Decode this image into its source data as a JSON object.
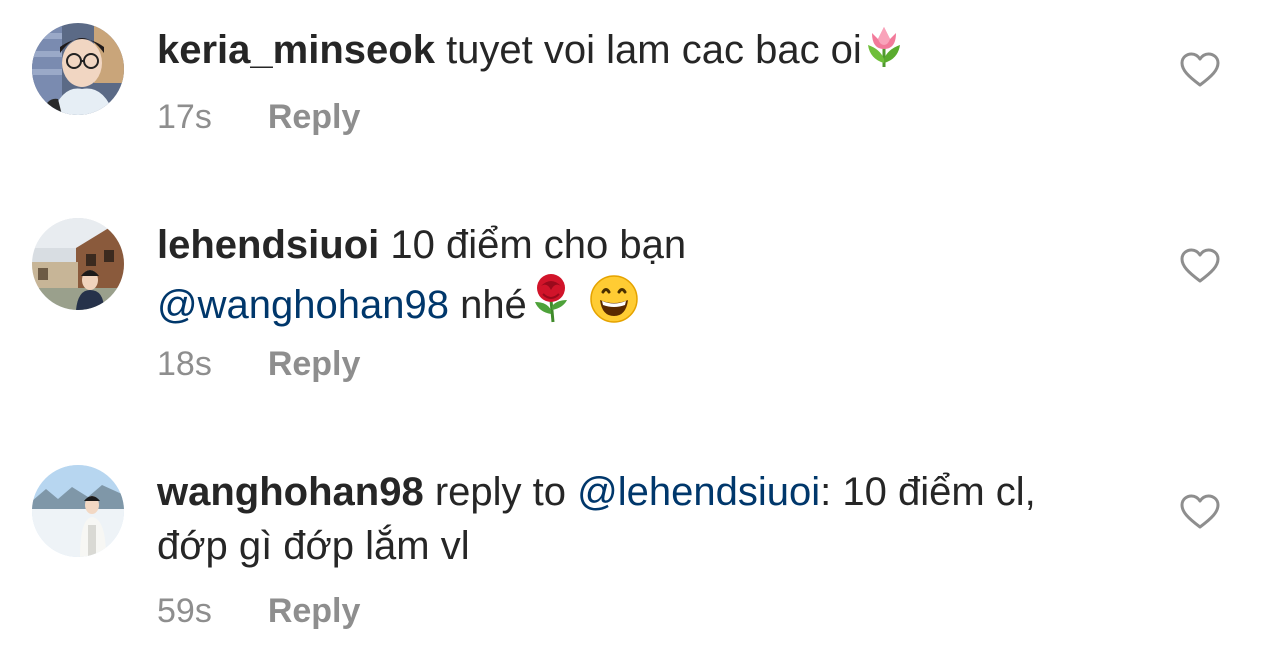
{
  "comments": [
    {
      "username": "keria_minseok",
      "text_before": " tuyet voi lam cac bac oi",
      "mention": "",
      "text_after": "",
      "emojis": [
        "tulip-emoji"
      ],
      "time": "17s",
      "reply_label": "Reply",
      "like_icon": "heart-outline-icon"
    },
    {
      "username": "lehendsiuoi",
      "text_before": " 10 điểm cho bạn ",
      "mention": "@wanghohan98",
      "text_after": " nhé",
      "emojis": [
        "rose-emoji",
        "grinning-face-emoji"
      ],
      "time": "18s",
      "reply_label": "Reply",
      "like_icon": "heart-outline-icon"
    },
    {
      "username": "wanghohan98",
      "text_before": " reply to ",
      "mention": "@lehendsiuoi",
      "text_after": ": 10 điểm cl, đớp gì đớp lắm vl",
      "emojis": [],
      "time": "59s",
      "reply_label": "Reply",
      "like_icon": "heart-outline-icon"
    }
  ],
  "colors": {
    "text": "#262626",
    "secondary": "#8e8e8e",
    "mention": "#00376b",
    "background": "#ffffff"
  }
}
